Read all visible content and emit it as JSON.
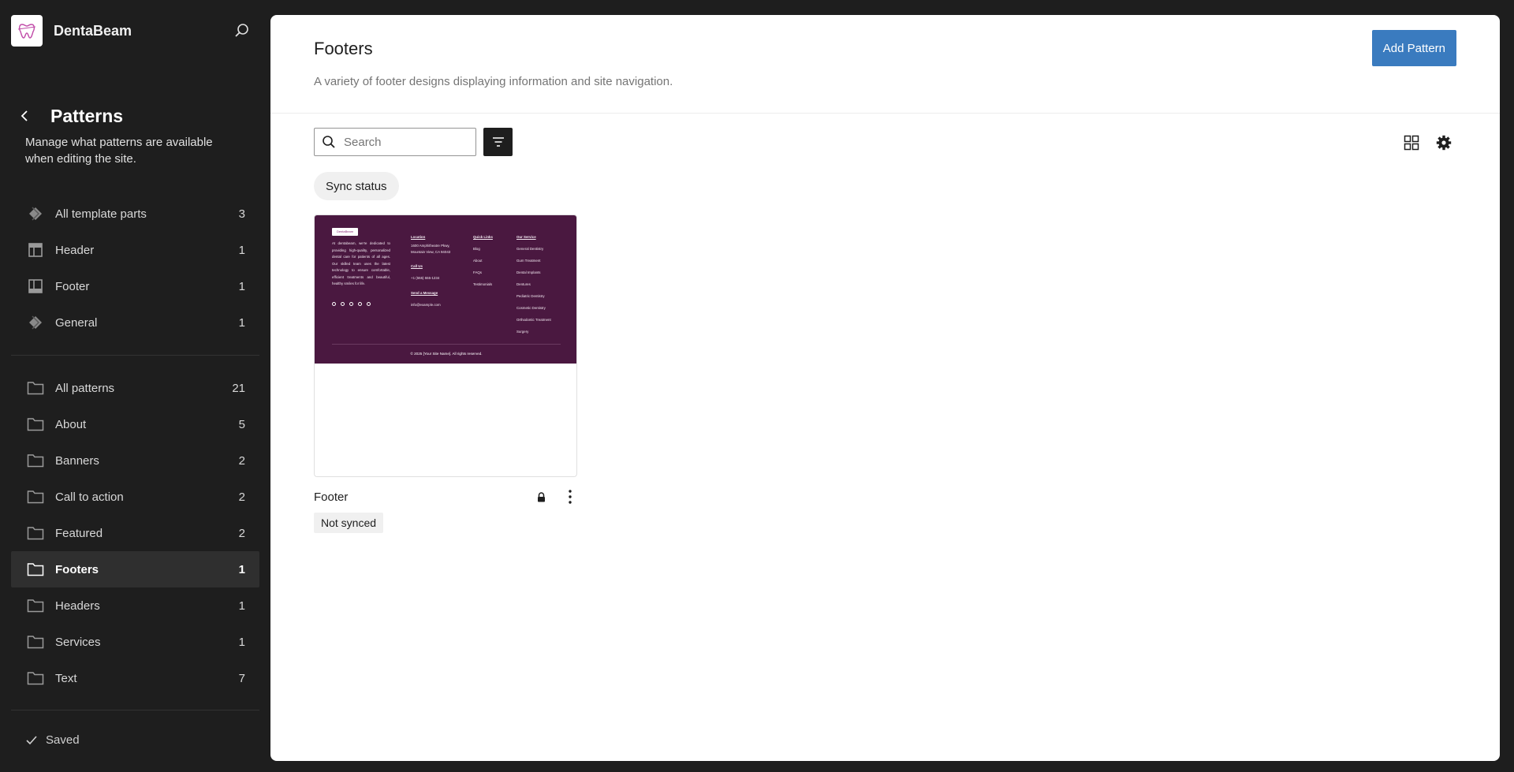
{
  "site": {
    "name": "DentaBeam"
  },
  "sidebar": {
    "title": "Patterns",
    "description": "Manage what patterns are available when editing the site.",
    "template_parts": [
      {
        "label": "All template parts",
        "count": "3",
        "icon": "diamond-icon"
      },
      {
        "label": "Header",
        "count": "1",
        "icon": "header-layout-icon"
      },
      {
        "label": "Footer",
        "count": "1",
        "icon": "footer-layout-icon"
      },
      {
        "label": "General",
        "count": "1",
        "icon": "diamond-icon"
      }
    ],
    "categories": [
      {
        "label": "All patterns",
        "count": "21",
        "icon": "folder-icon"
      },
      {
        "label": "About",
        "count": "5",
        "icon": "folder-icon"
      },
      {
        "label": "Banners",
        "count": "2",
        "icon": "folder-icon"
      },
      {
        "label": "Call to action",
        "count": "2",
        "icon": "folder-icon"
      },
      {
        "label": "Featured",
        "count": "2",
        "icon": "folder-icon"
      },
      {
        "label": "Footers",
        "count": "1",
        "icon": "folder-icon",
        "active": true
      },
      {
        "label": "Headers",
        "count": "1",
        "icon": "folder-icon"
      },
      {
        "label": "Services",
        "count": "1",
        "icon": "folder-icon"
      },
      {
        "label": "Text",
        "count": "7",
        "icon": "folder-icon"
      }
    ],
    "saved_label": "Saved"
  },
  "main": {
    "title": "Footers",
    "description": "A variety of footer designs displaying information and site navigation.",
    "add_button": "Add Pattern",
    "search": {
      "placeholder": "Search",
      "value": ""
    },
    "sync_chip": "Sync status",
    "card": {
      "title": "Footer",
      "badge": "Not synced",
      "preview": {
        "logo": "DentaBeam",
        "about_text": "At dentabeam, we're dedicated to providing high-quality, personalized dental care for patients of all ages. Our skilled team uses the latest technology to ensure comfortable, efficient treatments and beautiful, healthy smiles for life.",
        "location_heading": "Location",
        "location_line1": "1600 Amphitheatre Pkwy,",
        "location_line2": "Mountain View, CA 94043",
        "call_heading": "Call Us",
        "phone": "+1 (555) 555-1234",
        "message_heading": "Send a Message",
        "email": "info@example.com",
        "quick_heading": "Quick Links",
        "quick_links": [
          "Blog",
          "About",
          "FAQs",
          "Testimonials"
        ],
        "service_heading": "Our Service",
        "services": [
          "General Dentistry",
          "Gum Treatment",
          "Dental Implants",
          "Dentures",
          "Pediatric Dentistry",
          "Cosmetic Dentistry",
          "Orthodontic Treatment",
          "Surgery"
        ],
        "copyright": "© 2025 [Your Site Name]. All rights reserved."
      }
    }
  },
  "colors": {
    "sidebar_bg": "#1e1e1e",
    "accent": "#3a7bbf",
    "footer_preview_bg": "#4a1840"
  }
}
